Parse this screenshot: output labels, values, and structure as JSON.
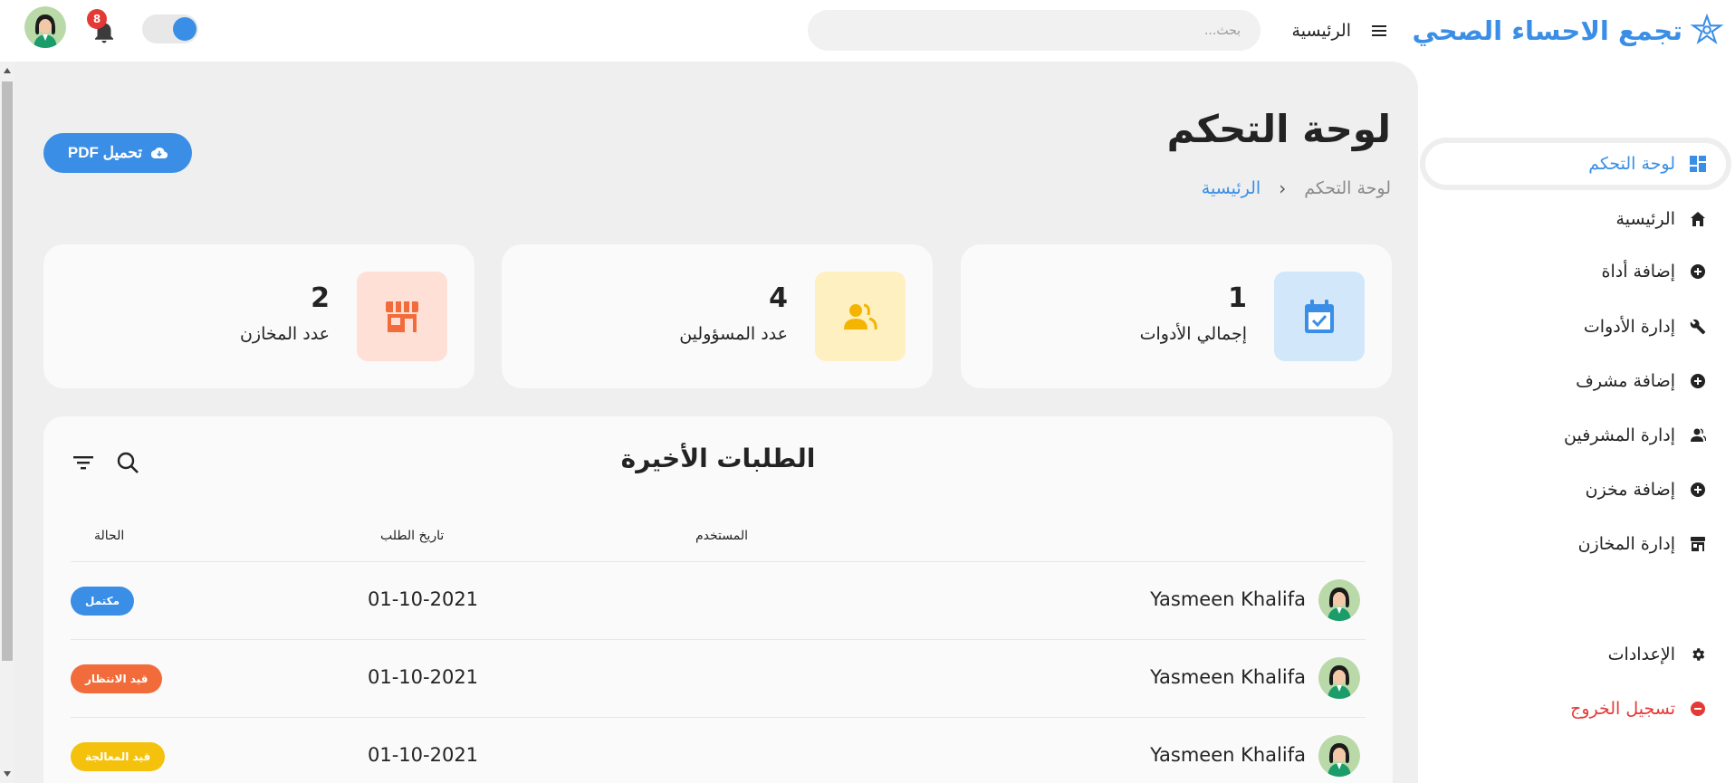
{
  "brand": {
    "name": "تجمع الاحساء الصحي",
    "color": "#3a8ee6"
  },
  "topbar": {
    "menu_icon": "hamburger-menu-icon",
    "home_link": "الرئيسية",
    "search_placeholder": "بحث...",
    "notifications_count": "8",
    "theme_toggle": "on"
  },
  "sidebar": {
    "items": [
      {
        "label": "لوحة التحكم",
        "icon": "dashboard-icon",
        "active": true
      },
      {
        "label": "الرئيسية",
        "icon": "home-icon"
      },
      {
        "label": "إضافة أداة",
        "icon": "add-circle-icon"
      },
      {
        "label": "إدارة الأدوات",
        "icon": "wrench-icon"
      },
      {
        "label": "إضافة مشرف",
        "icon": "add-circle-icon"
      },
      {
        "label": "إدارة المشرفين",
        "icon": "users-icon"
      },
      {
        "label": "إضافة مخزن",
        "icon": "add-circle-icon"
      },
      {
        "label": "إدارة المخازن",
        "icon": "store-icon"
      }
    ],
    "settings": {
      "label": "الإعدادات",
      "icon": "gear-icon"
    },
    "logout": {
      "label": "تسجيل الخروج",
      "icon": "logout-icon",
      "color": "#e53935"
    }
  },
  "page": {
    "title": "لوحة التحكم",
    "breadcrumb": {
      "current": "لوحة التحكم",
      "separator": "‹",
      "home": "الرئيسية"
    },
    "pdf_button": "تحميل PDF"
  },
  "stats": [
    {
      "value": "1",
      "label": "إجمالي الأدوات",
      "icon": "calendar-check-icon",
      "bg": "#d3e7fb",
      "fg": "#3a8ee6"
    },
    {
      "value": "4",
      "label": "عدد المسؤولين",
      "icon": "users-icon",
      "bg": "#fff0c2",
      "fg": "#f4b400"
    },
    {
      "value": "2",
      "label": "عدد المخازن",
      "icon": "store-icon",
      "bg": "#ffe0d6",
      "fg": "#f26b3a"
    }
  ],
  "orders": {
    "title": "الطلبات الأخيرة",
    "columns": {
      "user": "المستخدم",
      "date": "تاريخ الطلب",
      "status": "الحالة"
    },
    "rows": [
      {
        "user": "Yasmeen Khalifa",
        "date": "01-10-2021",
        "status": "مكتمل",
        "status_color": "#3a8ee6"
      },
      {
        "user": "Yasmeen Khalifa",
        "date": "01-10-2021",
        "status": "قيد الانتظار",
        "status_color": "#f26b3a"
      },
      {
        "user": "Yasmeen Khalifa",
        "date": "01-10-2021",
        "status": "قيد المعالجة",
        "status_color": "#f4c20d"
      }
    ]
  }
}
